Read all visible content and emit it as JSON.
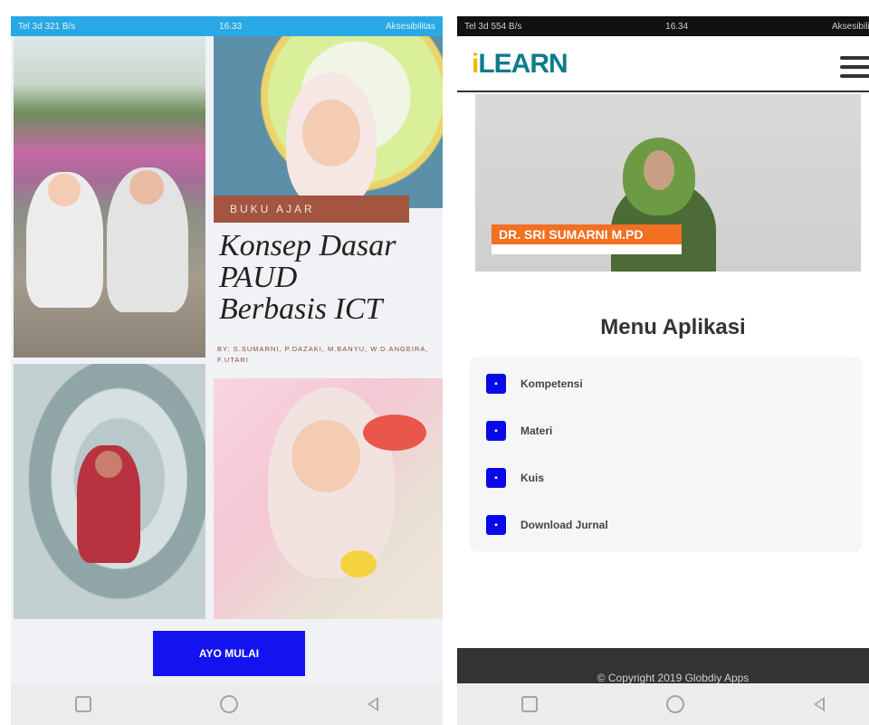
{
  "left_screen": {
    "status": {
      "left": "Tel 3d 321 B/s",
      "time": "16.33",
      "right": "Aksesibilitas"
    },
    "book": {
      "label": "BUKU AJAR",
      "title_line1": "Konsep Dasar",
      "title_line2": "PAUD",
      "title_line3": "Berbasis ICT",
      "authors": "By: S.Sumarni, P.Dazaki, M.Banyu, W.D.Angeira, F.Utari"
    },
    "start_button": "AYO MULAI"
  },
  "right_screen": {
    "status": {
      "left": "Tel 3d 554 B/s",
      "time": "16.34",
      "right": "Aksesibilitas"
    },
    "app_logo": {
      "i": "i",
      "rest": "LEARN"
    },
    "video_caption": "DR. SRI SUMARNI M.PD",
    "menu_title": "Menu Aplikasi",
    "menu_items": [
      {
        "label": "Kompetensi"
      },
      {
        "label": "Materi"
      },
      {
        "label": "Kuis"
      },
      {
        "label": "Download Jurnal"
      }
    ],
    "footer": "© Copyright 2019 Globdiy Apps"
  },
  "colors": {
    "primary_button": "#1313f0",
    "status_bar_left": "#29a8e6",
    "book_label_bg": "#a3553f",
    "video_caption_bg": "#f36f21",
    "logo_teal": "#0f7c8a",
    "logo_yellow": "#f2b705"
  },
  "icons": [
    "home-nav-icon",
    "recents-nav-icon",
    "back-nav-icon",
    "hamburger-menu-icon",
    "menu-item-icon"
  ]
}
